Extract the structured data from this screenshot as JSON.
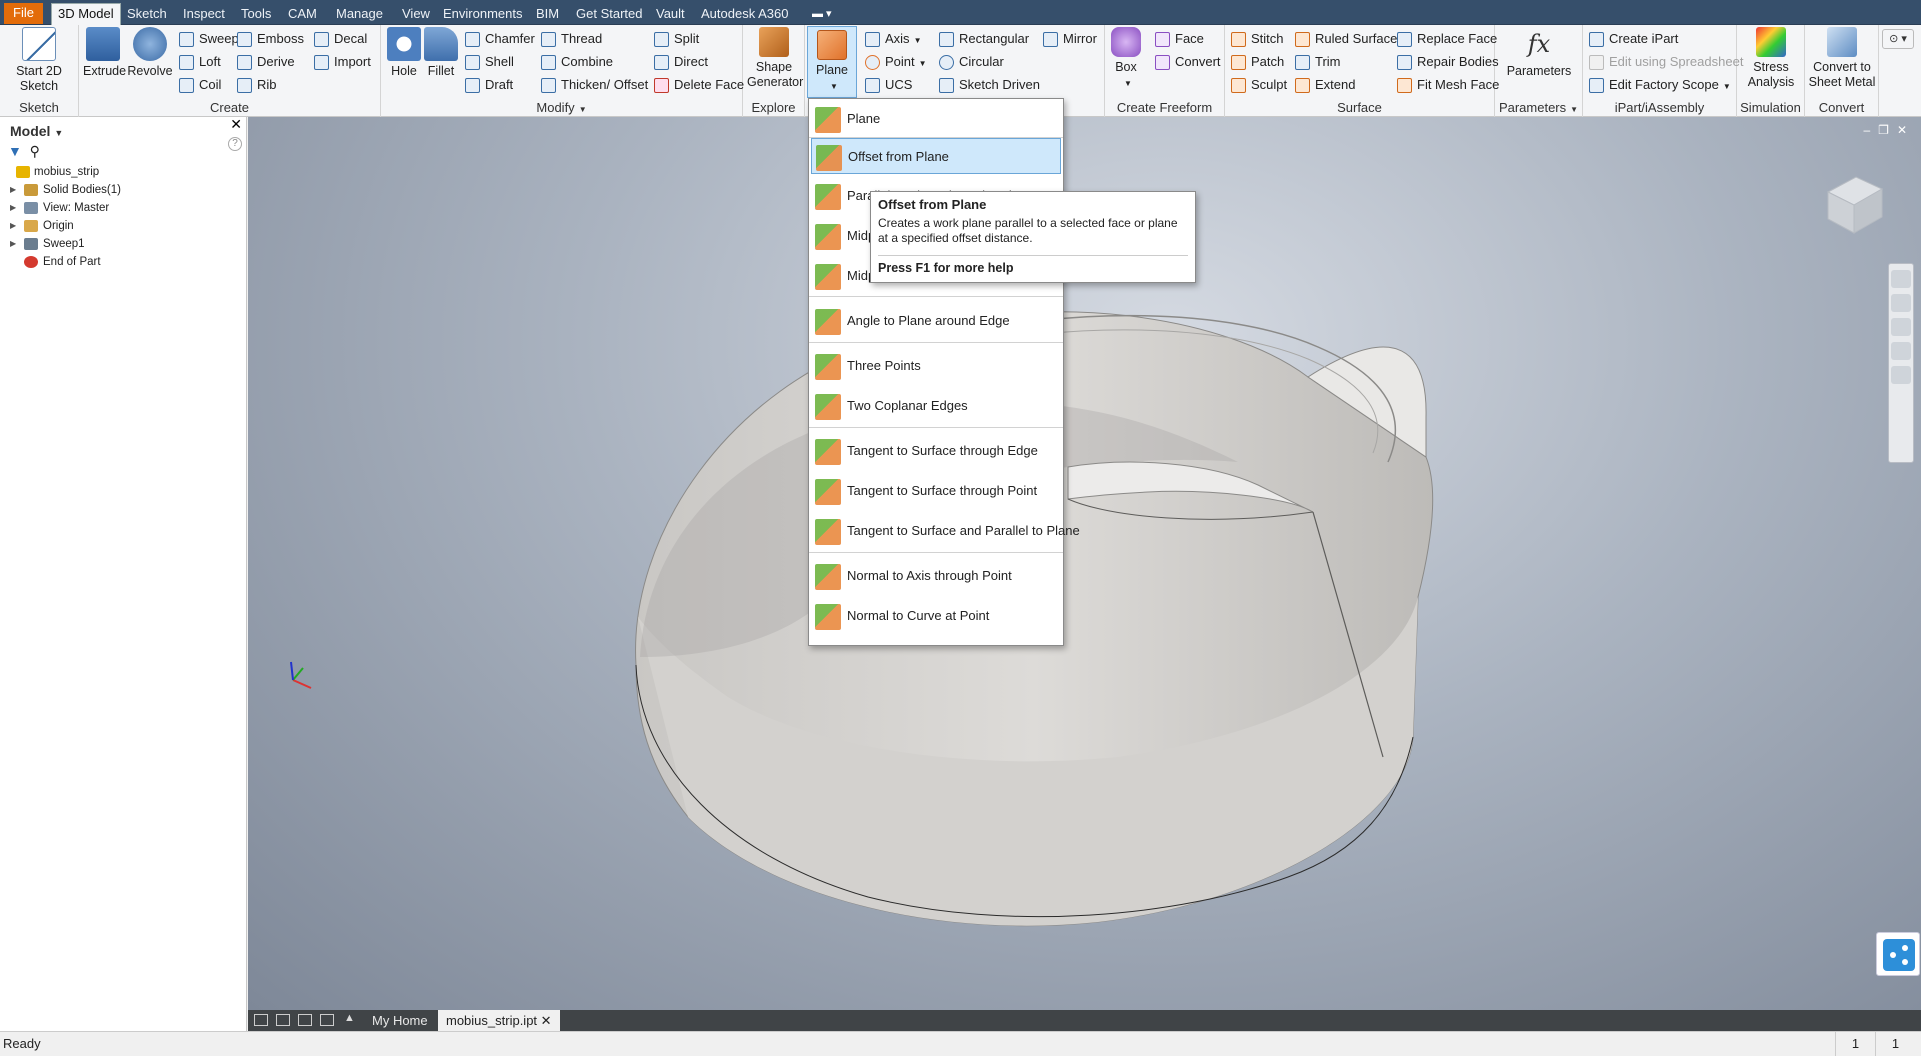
{
  "tabs": [
    "File",
    "3D Model",
    "Sketch",
    "Inspect",
    "Tools",
    "CAM",
    "Manage",
    "View",
    "Environments",
    "BIM",
    "Get Started",
    "Vault",
    "Autodesk A360"
  ],
  "ribbon": {
    "sketch": {
      "label": "Sketch",
      "start_2d_sketch": "Start 2D Sketch"
    },
    "create": {
      "label": "Create",
      "extrude": "Extrude",
      "revolve": "Revolve",
      "sweep": "Sweep",
      "loft": "Loft",
      "coil": "Coil",
      "emboss": "Emboss",
      "derive": "Derive",
      "rib": "Rib",
      "decal": "Decal",
      "import": "Import"
    },
    "modify": {
      "label": "Modify",
      "hole": "Hole",
      "fillet": "Fillet",
      "chamfer": "Chamfer",
      "shell": "Shell",
      "draft": "Draft",
      "thread": "Thread",
      "combine": "Combine",
      "thicken_offset": "Thicken/ Offset",
      "split": "Split",
      "direct": "Direct",
      "delete_face": "Delete Face"
    },
    "explore": {
      "label": "Explore",
      "shape_generator": "Shape Generator"
    },
    "work_features": {
      "plane": "Plane",
      "axis": "Axis",
      "point": "Point",
      "ucs": "UCS"
    },
    "pattern": {
      "rectangular": "Rectangular",
      "circular": "Circular",
      "sketch_driven": "Sketch Driven",
      "mirror": "Mirror"
    },
    "create_freeform": {
      "label": "Create Freeform",
      "box": "Box",
      "face": "Face",
      "convert": "Convert"
    },
    "surface": {
      "label": "Surface",
      "stitch": "Stitch",
      "patch": "Patch",
      "sculpt": "Sculpt",
      "ruled_surface": "Ruled Surface",
      "trim": "Trim",
      "extend": "Extend",
      "replace_face": "Replace Face",
      "repair_bodies": "Repair Bodies",
      "fit_mesh_face": "Fit Mesh Face"
    },
    "parameters": {
      "label": "Parameters",
      "parameters": "Parameters"
    },
    "ipart": {
      "label": "iPart/iAssembly",
      "create_ipart": "Create iPart",
      "edit_spreadsheet": "Edit using Spreadsheet",
      "edit_factory_scope": "Edit Factory Scope"
    },
    "simulation": {
      "label": "Simulation",
      "stress_analysis": "Stress Analysis"
    },
    "convert": {
      "label": "Convert",
      "convert_sheet_metal": "Convert to Sheet Metal"
    }
  },
  "browser": {
    "title": "Model",
    "items": [
      {
        "label": "mobius_strip",
        "expandable": false,
        "color": "#e7b400"
      },
      {
        "label": "Solid Bodies(1)",
        "expandable": true,
        "color": "#c99a3a"
      },
      {
        "label": "View: Master",
        "expandable": true,
        "color": "#7a8fa6"
      },
      {
        "label": "Origin",
        "expandable": true,
        "color": "#d9a84a"
      },
      {
        "label": "Sweep1",
        "expandable": true,
        "color": "#6b7d8f"
      },
      {
        "label": "End of Part",
        "expandable": false,
        "color": "#d43a2f"
      }
    ]
  },
  "dropdown": {
    "items": [
      {
        "label": "Plane",
        "highlighted": false
      },
      {
        "label": "Offset from Plane",
        "highlighted": true
      },
      {
        "label": "Parallel to Plane through Point",
        "highlighted": false
      },
      {
        "label": "Midplane between Two Planes",
        "highlighted": false
      },
      {
        "label": "Midplane of Torus",
        "highlighted": false
      },
      {
        "label": "Angle to Plane around Edge",
        "highlighted": false
      },
      {
        "label": "Three Points",
        "highlighted": false
      },
      {
        "label": "Two Coplanar Edges",
        "highlighted": false
      },
      {
        "label": "Tangent to Surface through Edge",
        "highlighted": false
      },
      {
        "label": "Tangent to Surface through Point",
        "highlighted": false
      },
      {
        "label": "Tangent to Surface and Parallel to Plane",
        "highlighted": false
      },
      {
        "label": "Normal to Axis through Point",
        "highlighted": false
      },
      {
        "label": "Normal to Curve at Point",
        "highlighted": false
      }
    ]
  },
  "tooltip": {
    "title": "Offset from Plane",
    "desc": "Creates a work plane parallel to a selected face or plane at a specified offset distance.",
    "help": "Press F1 for more help"
  },
  "doc_tabs": {
    "home": "My Home",
    "file": "mobius_strip.ipt"
  },
  "status": {
    "text": "Ready",
    "n1": "1",
    "n2": "1"
  },
  "colors": {
    "accent": "#e36c0a",
    "tabbar": "#364f6b",
    "highlight": "#cfe8fb"
  }
}
